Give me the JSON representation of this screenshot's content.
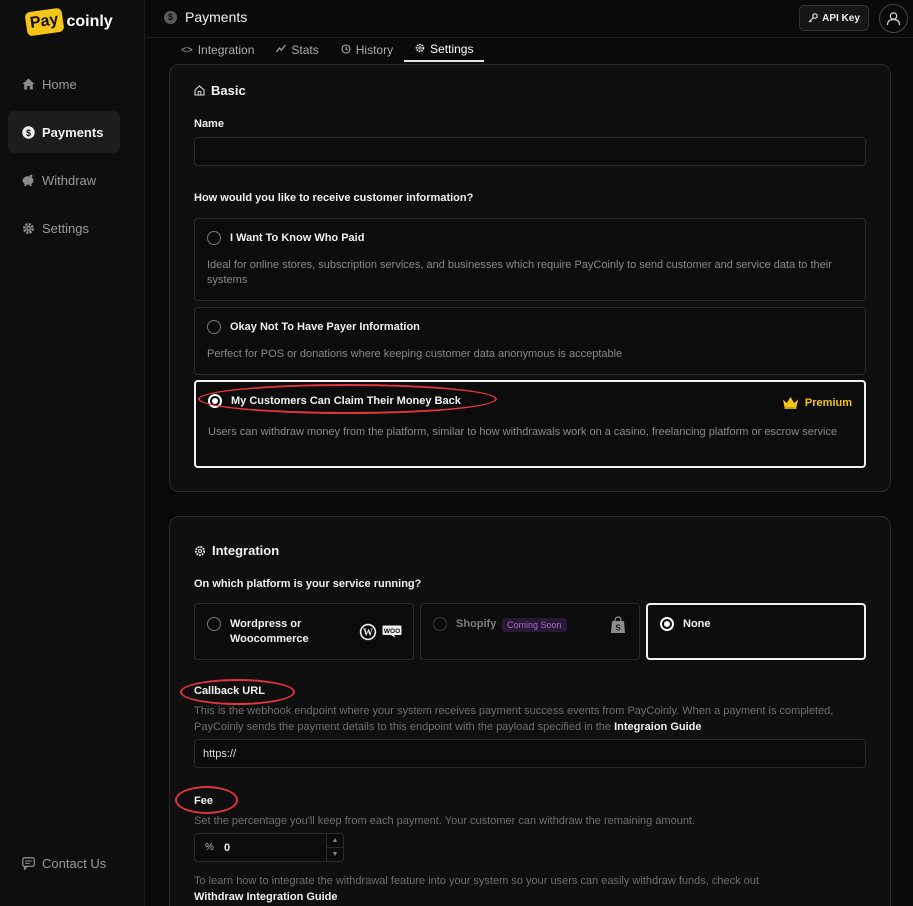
{
  "brand": {
    "badge": "Pay",
    "name": "coinly"
  },
  "sidebar": {
    "items": [
      {
        "label": "Home"
      },
      {
        "label": "Payments"
      },
      {
        "label": "Withdraw"
      },
      {
        "label": "Settings"
      }
    ],
    "footer": {
      "label": "Contact Us"
    }
  },
  "header": {
    "title": "Payments",
    "api_key_label": "API Key"
  },
  "tabs": [
    {
      "label": "Integration"
    },
    {
      "label": "Stats"
    },
    {
      "label": "History"
    },
    {
      "label": "Settings"
    }
  ],
  "basic": {
    "title": "Basic",
    "name_label": "Name",
    "name_value": "",
    "question": "How would you like to receive customer information?",
    "options": [
      {
        "title": "I Want To Know Who Paid",
        "desc": "Ideal for online stores, subscription services, and businesses which require PayCoinly to send customer and service data to their systems"
      },
      {
        "title": "Okay Not To Have Payer Information",
        "desc": "Perfect for POS or donations where keeping customer data anonymous is acceptable"
      },
      {
        "title": "My Customers Can Claim Their Money Back",
        "desc": "Users can withdraw money from the platform, similar to how withdrawals work on a casino, freelancing platform or escrow service",
        "badge": "Premium"
      }
    ]
  },
  "integration": {
    "title": "Integration",
    "question": "On which platform is your service running?",
    "platforms": [
      {
        "title_line1": "Wordpress or",
        "title_line2": "Woocommerce"
      },
      {
        "title": "Shopify",
        "badge": "Coming Soon"
      },
      {
        "title": "None"
      }
    ],
    "callback_label": "Callback URL",
    "callback_desc": "This is the webhook endpoint where your system receives payment success events from PayCoinly. When a payment is completed, PayCoinly sends the payment details to this endpoint with the payload specified in the ",
    "callback_link": "Integraion Guide",
    "callback_value": "https://",
    "fee_label": "Fee",
    "fee_desc": "Set the percentage you'll keep from each payment. Your customer can withdraw the remaining amount.",
    "fee_unit": "%",
    "fee_value": "0",
    "withdraw_desc": "To learn how to integrate the withdrawal feature into your system so your users can easily withdraw funds, check out",
    "withdraw_link": "Withdraw Integration Guide"
  },
  "colors": {
    "accent": "#f5c518",
    "annotation": "#e0353f",
    "background": "#0a0a0a"
  }
}
